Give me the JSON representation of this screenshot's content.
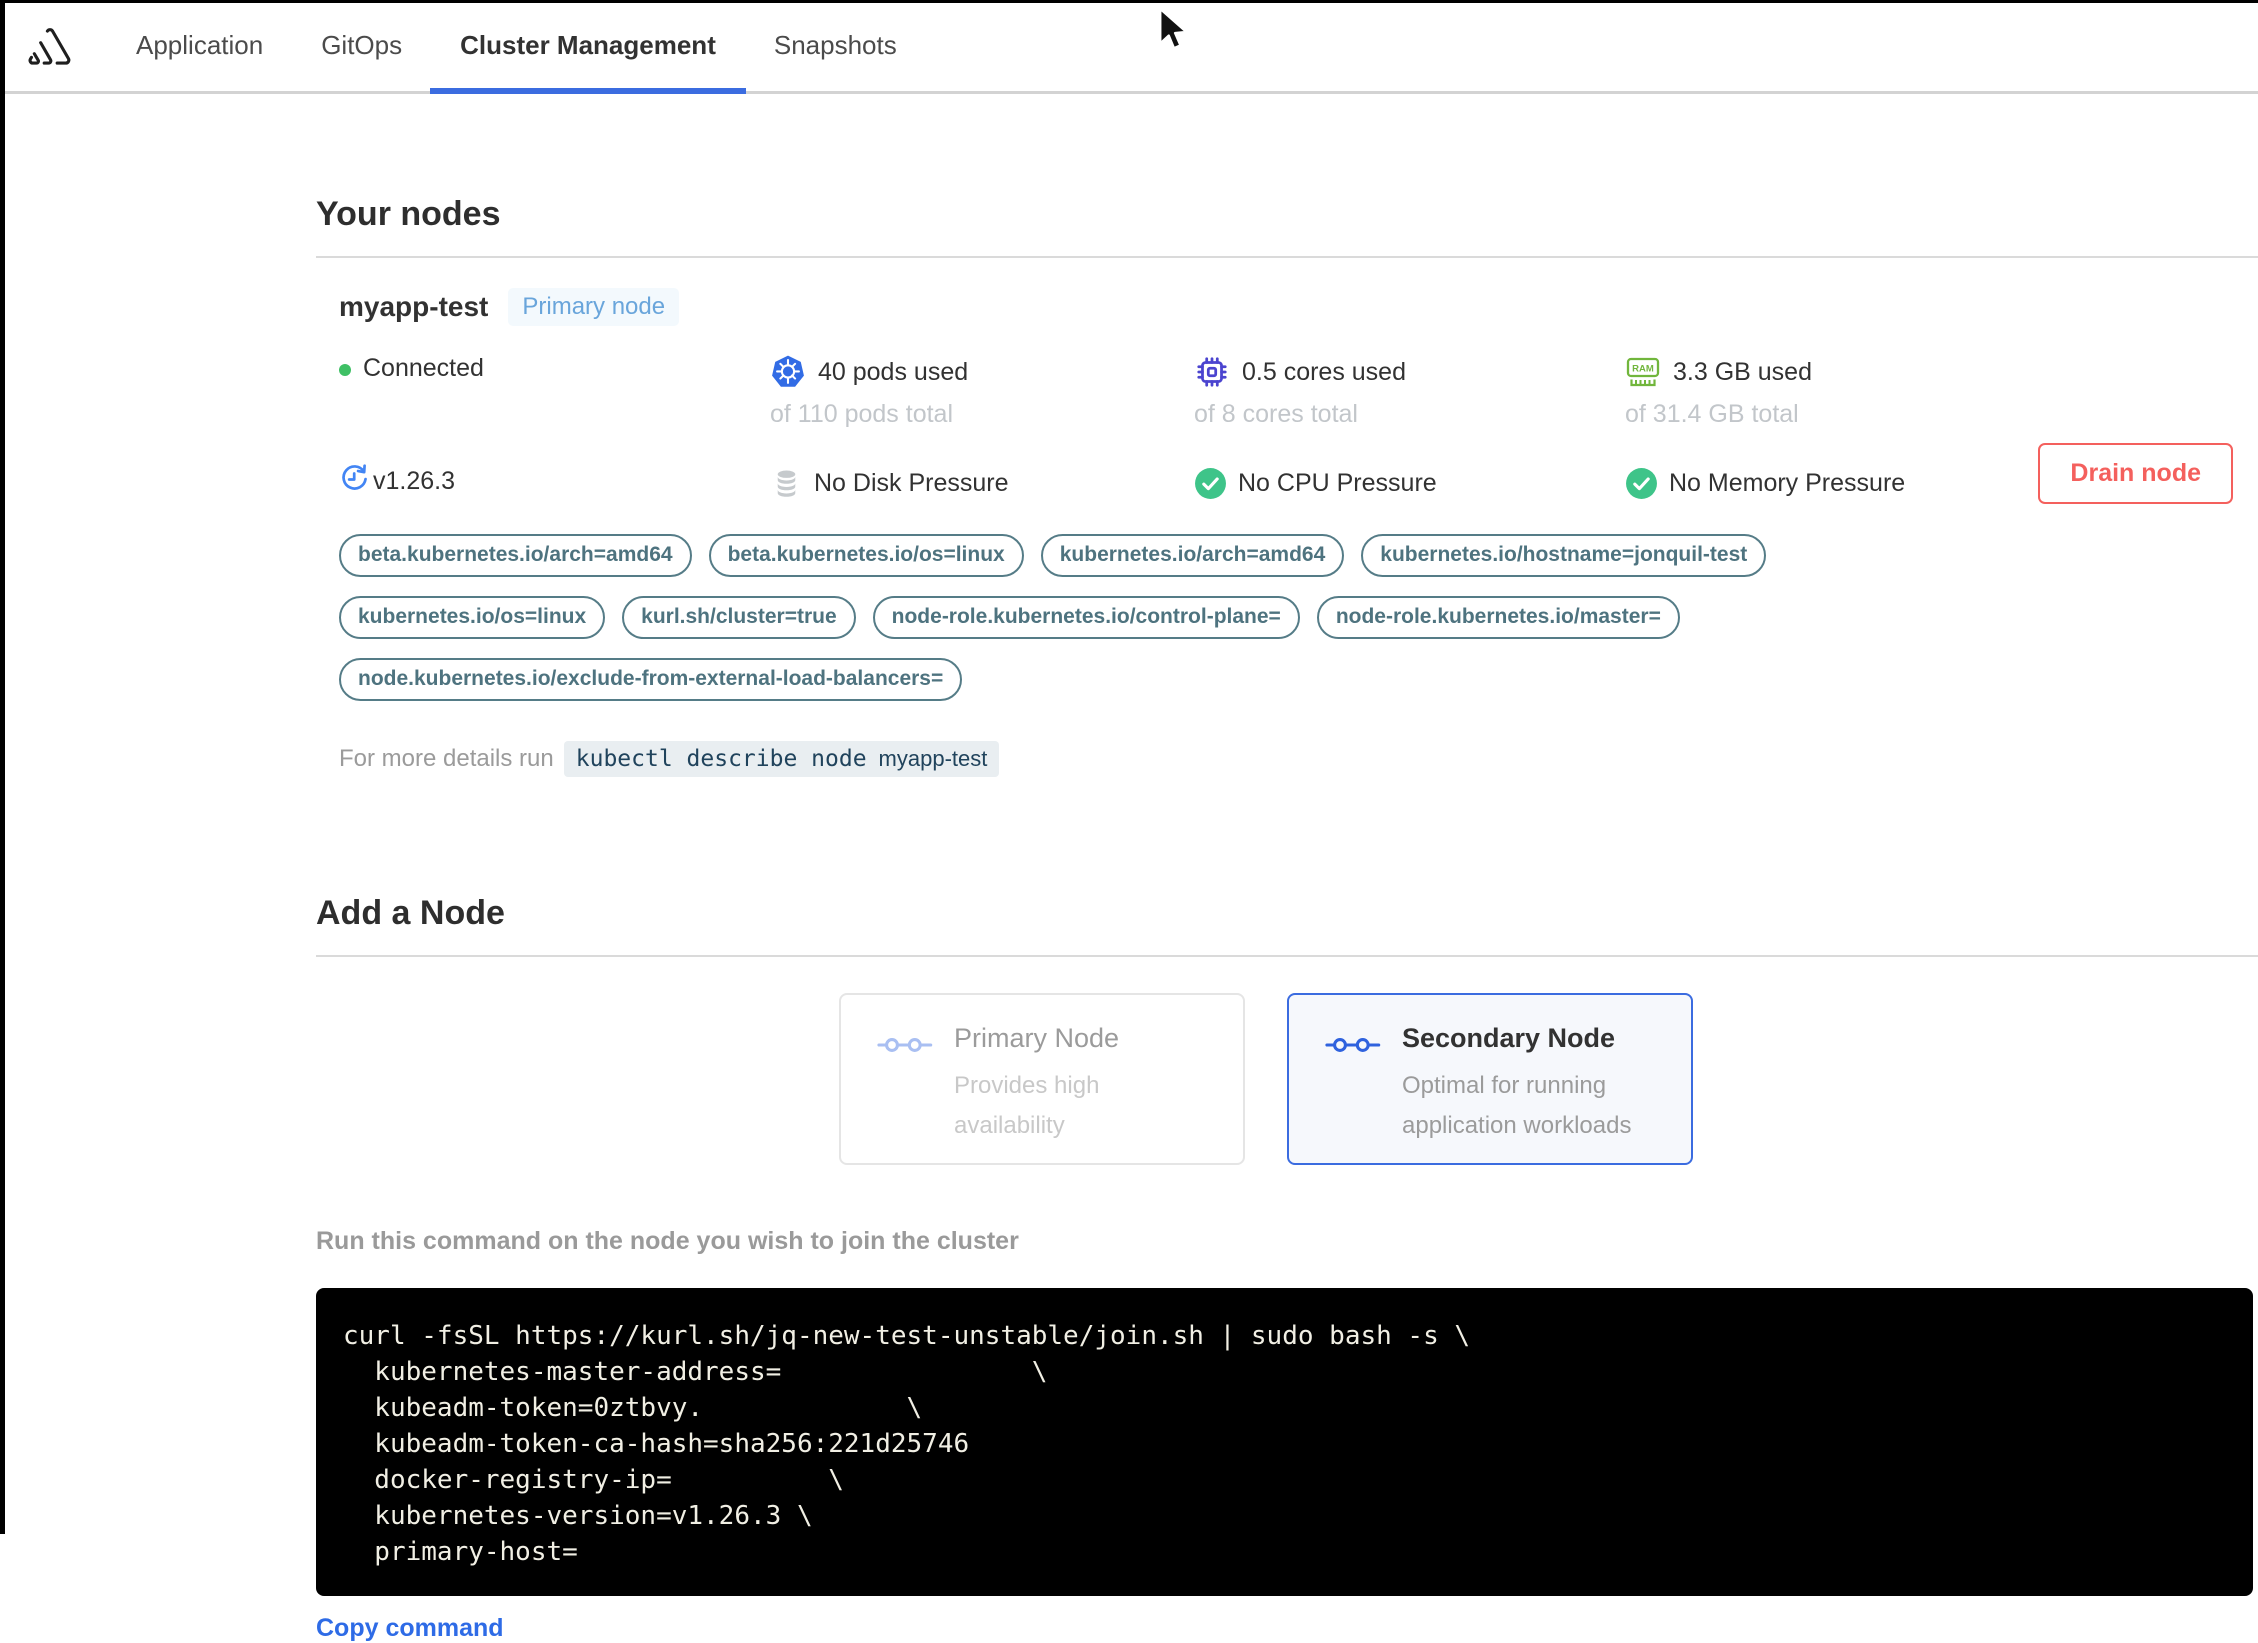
{
  "colors": {
    "accent-blue": "#3b6ce0",
    "link-blue": "#2e6be6",
    "badge-blue": "#69a5db",
    "chip-teal": "#557c87",
    "red": "#f4605d",
    "green-dot": "#3fc065",
    "check-green": "#3ec489",
    "k8s-blue": "#326ce5",
    "cpu-indigo": "#4b44cf",
    "ram-green": "#71b63c"
  },
  "nav": {
    "tabs": [
      {
        "label": "Application",
        "active": false
      },
      {
        "label": "GitOps",
        "active": false
      },
      {
        "label": "Cluster Management",
        "active": true
      },
      {
        "label": "Snapshots",
        "active": false
      }
    ]
  },
  "your_nodes": {
    "title": "Your nodes",
    "node": {
      "name": "myapp-test",
      "badge": "Primary node",
      "status": "Connected",
      "version": "v1.26.3",
      "stats": [
        {
          "icon": "kubernetes-icon",
          "used": "40 pods used",
          "total": "of 110 pods total"
        },
        {
          "icon": "cpu-icon",
          "used": "0.5 cores used",
          "total": "of 8 cores total"
        },
        {
          "icon": "ram-icon",
          "used": "3.3 GB used",
          "total": "of 31.4 GB total"
        }
      ],
      "conditions": [
        {
          "icon": "disk-icon",
          "label": "No Disk Pressure"
        },
        {
          "icon": "check-circle-icon",
          "label": "No CPU Pressure"
        },
        {
          "icon": "check-circle-icon",
          "label": "No Memory Pressure"
        }
      ],
      "labels": [
        "beta.kubernetes.io/arch=amd64",
        "beta.kubernetes.io/os=linux",
        "kubernetes.io/arch=amd64",
        "kubernetes.io/hostname=jonquil-test",
        "kubernetes.io/os=linux",
        "kurl.sh/cluster=true",
        "node-role.kubernetes.io/control-plane=",
        "node-role.kubernetes.io/master=",
        "node.kubernetes.io/exclude-from-external-load-balancers="
      ],
      "details_prefix": "For more details run",
      "details_command": "kubectl describe node",
      "details_node": "myapp-test",
      "drain_button": "Drain node"
    }
  },
  "add_node": {
    "title": "Add a Node",
    "options": [
      {
        "title": "Primary Node",
        "description": "Provides high availability",
        "selected": false
      },
      {
        "title": "Secondary Node",
        "description": "Optimal for running application workloads",
        "selected": true
      }
    ],
    "instruction": "Run this command on the node you wish to join the cluster",
    "command_lines": [
      "curl -fsSL https://kurl.sh/jq-new-test-unstable/join.sh | sudo bash -s \\",
      "  kubernetes-master-address=                \\",
      "  kubeadm-token=0ztbvy.             \\",
      "  kubeadm-token-ca-hash=sha256:221d25746",
      "  docker-registry-ip=          \\",
      "  kubernetes-version=v1.26.3 \\",
      "  primary-host="
    ],
    "copy_label": "Copy command"
  }
}
